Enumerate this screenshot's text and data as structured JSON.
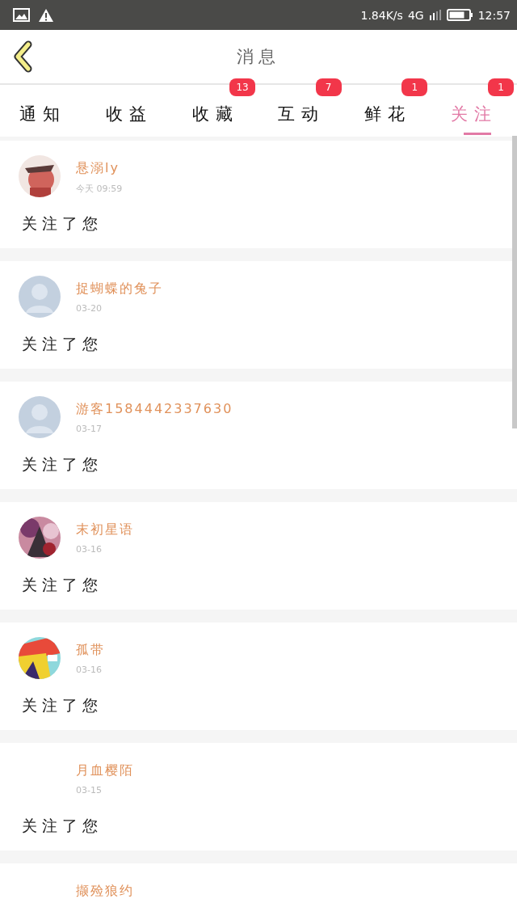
{
  "status_bar": {
    "net_speed": "1.84K/s",
    "network": "4G",
    "time": "12:57"
  },
  "header": {
    "title": "消息"
  },
  "tabs": [
    {
      "label": "通知",
      "selected": false
    },
    {
      "label": "收益",
      "selected": false
    },
    {
      "label": "收藏",
      "selected": false,
      "badge": "13"
    },
    {
      "label": "互动",
      "selected": false,
      "badge": "7"
    },
    {
      "label": "鲜花",
      "selected": false,
      "badge": "1"
    },
    {
      "label": "关注",
      "selected": true,
      "badge": "1"
    }
  ],
  "messages": [
    {
      "name": "悬溺ly",
      "time": "今天 09:59",
      "text": "关注了您"
    },
    {
      "name": "捉蝴蝶的兔子",
      "time": "03-20",
      "avatar": {
        "kind": "default"
      },
      "text": "关注了您"
    },
    {
      "name": "游客1584442337630",
      "time": "03-17",
      "avatar": {
        "kind": "default"
      },
      "text": "关注了您"
    },
    {
      "name": "末初星语",
      "time": "03-16",
      "text": "关注了您"
    },
    {
      "name": "孤带",
      "time": "03-16",
      "text": "关注了您"
    },
    {
      "name": "月血樱陌",
      "time": "03-15",
      "text": "关注了您"
    },
    {
      "name": "撷殓狼约"
    }
  ]
}
